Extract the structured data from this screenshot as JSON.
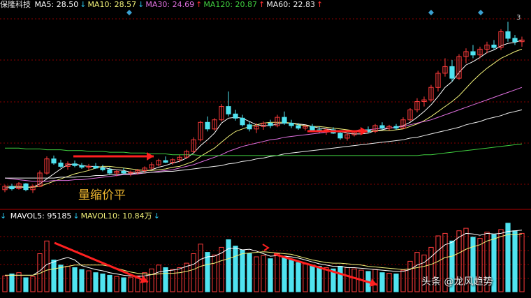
{
  "stock_name": "保隆科技",
  "ma_legend": [
    {
      "label": "MA5: 28.50",
      "arrow": "↓",
      "color": "#ffffff",
      "dir": "down"
    },
    {
      "label": "MA10: 28.57",
      "arrow": "↓",
      "color": "#f2f27a",
      "dir": "down"
    },
    {
      "label": "MA30: 24.69",
      "arrow": "↑",
      "color": "#e070e0",
      "dir": "up"
    },
    {
      "label": "MA120: 20.87",
      "arrow": "↑",
      "color": "#40d040",
      "dir": "up"
    },
    {
      "label": "MA60: 22.83",
      "arrow": "↑",
      "color": "#f0f0f0",
      "dir": "up"
    }
  ],
  "vol_legend": [
    {
      "label": "MAVOL5: 95185",
      "arrow": "↓",
      "color": "#ffffff",
      "dir": "down"
    },
    {
      "label": "MAVOL10: 10.84万",
      "arrow": "↓",
      "color": "#f2f27a",
      "dir": "down"
    }
  ],
  "vol_prefix_arrow": "↓",
  "annotation": "量缩价平",
  "high_label": "3",
  "watermark": "头条 @龙风趋势",
  "colors": {
    "up": "#ff3b3b",
    "down": "#4fe3f0",
    "arrow": "#ff2020",
    "grid": "#8a0000"
  },
  "chart_data": {
    "type": "candlestick",
    "candles": [
      [
        17.2,
        17.8,
        16.9,
        17.6
      ],
      [
        17.6,
        17.9,
        17.1,
        17.3
      ],
      [
        17.3,
        18.1,
        17.2,
        17.9
      ],
      [
        17.9,
        18.0,
        17.0,
        17.2
      ],
      [
        17.2,
        17.8,
        16.8,
        17.6
      ],
      [
        17.6,
        19.5,
        17.5,
        19.2
      ],
      [
        19.2,
        21.2,
        19.0,
        20.9
      ],
      [
        20.9,
        21.3,
        20.2,
        20.4
      ],
      [
        20.4,
        20.8,
        19.8,
        20.0
      ],
      [
        20.0,
        20.6,
        19.6,
        20.3
      ],
      [
        20.3,
        20.7,
        19.9,
        20.1
      ],
      [
        20.1,
        20.4,
        19.7,
        19.9
      ],
      [
        19.9,
        20.3,
        19.5,
        20.0
      ],
      [
        20.0,
        20.4,
        19.7,
        19.8
      ],
      [
        19.8,
        20.2,
        19.4,
        19.6
      ],
      [
        19.6,
        19.9,
        19.0,
        19.2
      ],
      [
        19.2,
        19.6,
        18.8,
        19.4
      ],
      [
        19.4,
        19.8,
        19.0,
        19.2
      ],
      [
        19.2,
        19.5,
        18.8,
        19.3
      ],
      [
        19.3,
        19.7,
        19.0,
        19.5
      ],
      [
        19.5,
        20.0,
        19.2,
        19.8
      ],
      [
        19.8,
        20.5,
        19.6,
        20.2
      ],
      [
        20.2,
        20.9,
        20.0,
        20.7
      ],
      [
        20.7,
        21.2,
        20.4,
        20.5
      ],
      [
        20.5,
        21.0,
        20.2,
        20.8
      ],
      [
        20.8,
        21.4,
        20.5,
        21.1
      ],
      [
        21.1,
        22.0,
        20.9,
        21.8
      ],
      [
        21.8,
        23.5,
        21.6,
        23.2
      ],
      [
        23.2,
        25.5,
        23.0,
        25.3
      ],
      [
        25.3,
        26.0,
        24.2,
        24.5
      ],
      [
        24.5,
        25.8,
        24.3,
        25.6
      ],
      [
        25.6,
        27.5,
        25.4,
        27.2
      ],
      [
        27.2,
        29.0,
        26.0,
        26.3
      ],
      [
        26.3,
        26.8,
        25.5,
        25.8
      ],
      [
        25.8,
        26.2,
        24.8,
        25.0
      ],
      [
        25.0,
        25.4,
        24.2,
        24.5
      ],
      [
        24.5,
        25.2,
        24.0,
        24.8
      ],
      [
        24.8,
        25.4,
        24.4,
        25.2
      ],
      [
        25.2,
        25.6,
        24.6,
        24.9
      ],
      [
        24.9,
        26.2,
        24.7,
        25.9
      ],
      [
        25.9,
        26.6,
        25.0,
        25.2
      ],
      [
        25.2,
        25.6,
        24.6,
        24.9
      ],
      [
        24.9,
        25.2,
        24.4,
        24.6
      ],
      [
        24.6,
        25.0,
        24.3,
        24.8
      ],
      [
        24.8,
        25.1,
        24.2,
        24.4
      ],
      [
        24.4,
        24.8,
        24.0,
        24.2
      ],
      [
        24.2,
        24.6,
        23.8,
        24.4
      ],
      [
        24.4,
        24.7,
        23.9,
        24.0
      ],
      [
        24.0,
        24.3,
        23.2,
        23.4
      ],
      [
        23.4,
        24.0,
        23.1,
        23.8
      ],
      [
        23.8,
        24.3,
        23.6,
        24.1
      ],
      [
        24.1,
        24.6,
        23.9,
        24.4
      ],
      [
        24.4,
        24.8,
        24.0,
        24.2
      ],
      [
        24.2,
        25.1,
        24.0,
        24.9
      ],
      [
        24.9,
        25.3,
        24.4,
        24.6
      ],
      [
        24.6,
        25.0,
        24.3,
        24.8
      ],
      [
        24.8,
        25.1,
        24.4,
        24.6
      ],
      [
        24.6,
        25.9,
        24.5,
        25.6
      ],
      [
        25.6,
        27.0,
        25.4,
        26.8
      ],
      [
        26.8,
        28.2,
        26.5,
        27.8
      ],
      [
        27.8,
        28.4,
        27.2,
        28.0
      ],
      [
        28.0,
        29.8,
        27.8,
        29.5
      ],
      [
        29.5,
        31.5,
        29.0,
        31.2
      ],
      [
        31.2,
        33.0,
        30.8,
        32.0
      ],
      [
        32.0,
        32.8,
        30.2,
        30.6
      ],
      [
        30.6,
        33.5,
        30.4,
        33.2
      ],
      [
        33.2,
        34.2,
        32.4,
        33.8
      ],
      [
        33.8,
        34.6,
        33.0,
        33.4
      ],
      [
        33.4,
        34.4,
        33.0,
        34.1
      ],
      [
        34.1,
        35.0,
        33.6,
        34.6
      ],
      [
        34.6,
        35.2,
        34.0,
        34.3
      ],
      [
        34.3,
        36.5,
        34.0,
        36.2
      ],
      [
        36.2,
        37.4,
        35.0,
        35.4
      ],
      [
        35.4,
        35.8,
        34.6,
        35.0
      ],
      [
        35.0,
        35.6,
        34.4,
        35.2
      ]
    ],
    "ma_lines": [
      {
        "name": "MA5",
        "color": "#ffffff",
        "values": [
          17.4,
          17.5,
          17.5,
          17.5,
          17.5,
          17.9,
          18.5,
          19.1,
          19.7,
          20.2,
          20.3,
          20.1,
          20.0,
          20.0,
          19.9,
          19.7,
          19.6,
          19.5,
          19.3,
          19.3,
          19.4,
          19.6,
          19.9,
          20.1,
          20.4,
          20.6,
          21.0,
          21.6,
          22.5,
          23.2,
          24.0,
          25.2,
          25.8,
          25.9,
          25.8,
          25.4,
          25.0,
          24.9,
          24.9,
          25.1,
          25.2,
          25.2,
          25.1,
          25.0,
          24.8,
          24.6,
          24.5,
          24.4,
          24.2,
          24.0,
          23.9,
          23.9,
          24.0,
          24.3,
          24.4,
          24.6,
          24.7,
          24.9,
          25.3,
          25.9,
          26.6,
          27.4,
          28.4,
          29.5,
          30.2,
          31.3,
          32.2,
          32.6,
          33.1,
          33.7,
          34.0,
          34.5,
          34.8,
          34.9,
          35.2
        ]
      },
      {
        "name": "MA10",
        "color": "#f2f27a",
        "values": [
          17.6,
          17.6,
          17.6,
          17.5,
          17.5,
          17.6,
          17.9,
          18.2,
          18.5,
          18.8,
          19.1,
          19.3,
          19.5,
          19.8,
          20.0,
          20.0,
          19.9,
          19.8,
          19.7,
          19.6,
          19.5,
          19.5,
          19.6,
          19.7,
          19.9,
          20.0,
          20.3,
          20.6,
          21.2,
          21.7,
          22.2,
          22.9,
          23.6,
          24.2,
          24.5,
          24.8,
          25.0,
          25.2,
          25.3,
          25.3,
          25.3,
          25.2,
          25.0,
          24.9,
          24.8,
          24.8,
          24.7,
          24.6,
          24.5,
          24.4,
          24.3,
          24.2,
          24.2,
          24.3,
          24.3,
          24.3,
          24.4,
          24.5,
          24.8,
          25.1,
          25.5,
          26.0,
          26.6,
          27.2,
          27.8,
          28.5,
          29.4,
          30.3,
          31.1,
          31.8,
          32.4,
          33.0,
          33.4,
          33.8,
          34.1
        ]
      },
      {
        "name": "MA30",
        "color": "#e070e0",
        "values": [
          18.6,
          18.5,
          18.4,
          18.3,
          18.2,
          18.2,
          18.2,
          18.3,
          18.3,
          18.3,
          18.4,
          18.4,
          18.5,
          18.6,
          18.7,
          18.8,
          18.9,
          19.0,
          19.0,
          19.1,
          19.2,
          19.3,
          19.4,
          19.5,
          19.6,
          19.8,
          20.0,
          20.2,
          20.5,
          20.8,
          21.1,
          21.4,
          21.8,
          22.1,
          22.4,
          22.6,
          22.8,
          23.0,
          23.2,
          23.3,
          23.5,
          23.6,
          23.7,
          23.8,
          23.9,
          24.0,
          24.1,
          24.2,
          24.2,
          24.3,
          24.3,
          24.4,
          24.4,
          24.5,
          24.6,
          24.6,
          24.7,
          24.8,
          25.0,
          25.2,
          25.4,
          25.6,
          25.9,
          26.2,
          26.5,
          26.8,
          27.1,
          27.4,
          27.7,
          28.0,
          28.3,
          28.6,
          28.9,
          29.2,
          29.5
        ]
      },
      {
        "name": "MA60",
        "color": "#f0f0f0",
        "values": [
          18.6,
          18.6,
          18.6,
          18.6,
          18.6,
          18.6,
          18.6,
          18.6,
          18.7,
          18.7,
          18.7,
          18.8,
          18.8,
          18.9,
          18.9,
          19.0,
          19.0,
          19.1,
          19.1,
          19.2,
          19.2,
          19.3,
          19.3,
          19.4,
          19.4,
          19.5,
          19.6,
          19.7,
          19.8,
          19.9,
          20.0,
          20.1,
          20.3,
          20.4,
          20.6,
          20.7,
          20.9,
          21.0,
          21.2,
          21.3,
          21.5,
          21.6,
          21.7,
          21.8,
          21.9,
          22.0,
          22.1,
          22.2,
          22.3,
          22.4,
          22.5,
          22.6,
          22.7,
          22.8,
          22.9,
          23.0,
          23.1,
          23.2,
          23.4,
          23.5,
          23.7,
          23.9,
          24.1,
          24.3,
          24.5,
          24.7,
          25.0,
          25.2,
          25.4,
          25.7,
          25.9,
          26.1,
          26.4,
          26.6,
          26.8
        ]
      },
      {
        "name": "MA120",
        "color": "#40d040",
        "values": [
          22.2,
          22.2,
          22.2,
          22.1,
          22.1,
          22.1,
          22.0,
          22.0,
          22.0,
          21.9,
          21.9,
          21.9,
          21.8,
          21.8,
          21.8,
          21.7,
          21.7,
          21.7,
          21.6,
          21.6,
          21.6,
          21.5,
          21.5,
          21.5,
          21.4,
          21.4,
          21.4,
          21.4,
          21.3,
          21.3,
          21.3,
          21.3,
          21.3,
          21.3,
          21.3,
          21.3,
          21.3,
          21.3,
          21.3,
          21.3,
          21.3,
          21.3,
          21.3,
          21.3,
          21.3,
          21.3,
          21.3,
          21.3,
          21.3,
          21.3,
          21.3,
          21.3,
          21.3,
          21.3,
          21.3,
          21.3,
          21.3,
          21.3,
          21.3,
          21.3,
          21.4,
          21.4,
          21.5,
          21.6,
          21.7,
          21.8,
          21.9,
          22.0,
          22.1,
          22.2,
          22.3,
          22.4,
          22.5,
          22.6,
          22.7
        ]
      }
    ],
    "volume": [
      25,
      28,
      30,
      22,
      24,
      60,
      80,
      50,
      42,
      40,
      38,
      35,
      33,
      30,
      28,
      26,
      24,
      22,
      23,
      25,
      30,
      36,
      42,
      38,
      35,
      38,
      45,
      60,
      75,
      62,
      58,
      70,
      82,
      72,
      66,
      60,
      55,
      57,
      52,
      60,
      56,
      50,
      46,
      44,
      42,
      40,
      38,
      36,
      40,
      38,
      36,
      34,
      32,
      35,
      30,
      29,
      28,
      34,
      48,
      62,
      58,
      70,
      88,
      92,
      80,
      96,
      100,
      86,
      84,
      94,
      90,
      98,
      108,
      96,
      92
    ],
    "vol_ma_lines": [
      {
        "name": "MAVOL5",
        "color": "#ffffff",
        "values": [
          26,
          26,
          26,
          26,
          26,
          33,
          43,
          47,
          51,
          54,
          50,
          41,
          38,
          35,
          33,
          30,
          28,
          26,
          25,
          24,
          25,
          27,
          31,
          33,
          34,
          36,
          40,
          43,
          51,
          55,
          56,
          61,
          68,
          69,
          66,
          67,
          64,
          60,
          56,
          57,
          56,
          55,
          53,
          50,
          47,
          44,
          42,
          40,
          40,
          38,
          38,
          37,
          36,
          35,
          34,
          33,
          32,
          32,
          35,
          42,
          46,
          55,
          65,
          74,
          78,
          86,
          92,
          91,
          89,
          92,
          91,
          92,
          95,
          96,
          97
        ]
      },
      {
        "name": "MAVOL10",
        "color": "#f2f27a",
        "values": [
          26,
          26,
          26,
          26,
          26,
          29,
          34,
          36,
          38,
          40,
          42,
          42,
          42,
          42,
          42,
          40,
          37,
          34,
          31,
          29,
          28,
          27,
          28,
          29,
          29,
          30,
          32,
          35,
          40,
          43,
          45,
          49,
          52,
          56,
          60,
          61,
          62,
          63,
          62,
          61,
          60,
          59,
          56,
          53,
          50,
          48,
          46,
          45,
          45,
          44,
          43,
          42,
          40,
          39,
          38,
          37,
          36,
          35,
          36,
          38,
          40,
          43,
          48,
          54,
          56,
          61,
          67,
          71,
          74,
          80,
          83,
          87,
          90,
          90,
          91
        ]
      }
    ],
    "annotations": [
      "量缩价平"
    ]
  }
}
